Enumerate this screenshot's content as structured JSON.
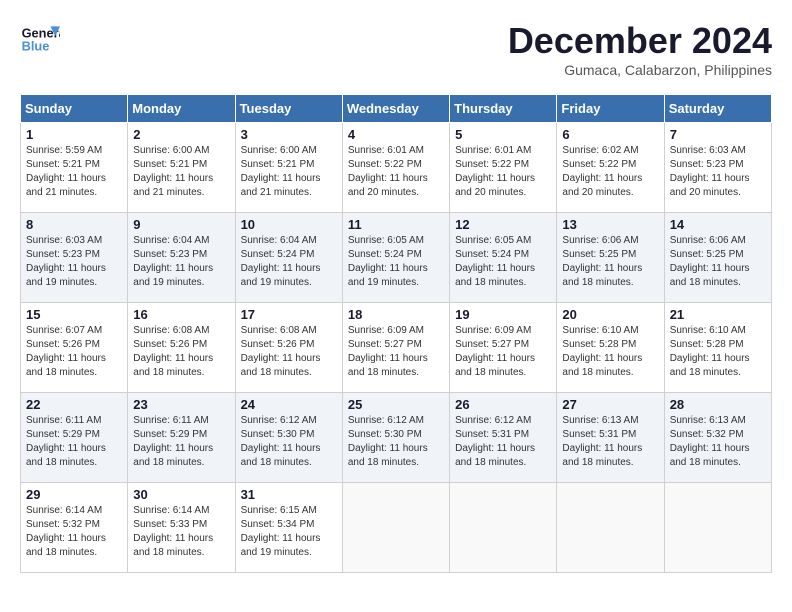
{
  "logo": {
    "line1": "General",
    "line2": "Blue"
  },
  "title": "December 2024",
  "subtitle": "Gumaca, Calabarzon, Philippines",
  "days_of_week": [
    "Sunday",
    "Monday",
    "Tuesday",
    "Wednesday",
    "Thursday",
    "Friday",
    "Saturday"
  ],
  "weeks": [
    [
      {
        "day": "1",
        "info": "Sunrise: 5:59 AM\nSunset: 5:21 PM\nDaylight: 11 hours\nand 21 minutes."
      },
      {
        "day": "2",
        "info": "Sunrise: 6:00 AM\nSunset: 5:21 PM\nDaylight: 11 hours\nand 21 minutes."
      },
      {
        "day": "3",
        "info": "Sunrise: 6:00 AM\nSunset: 5:21 PM\nDaylight: 11 hours\nand 21 minutes."
      },
      {
        "day": "4",
        "info": "Sunrise: 6:01 AM\nSunset: 5:22 PM\nDaylight: 11 hours\nand 20 minutes."
      },
      {
        "day": "5",
        "info": "Sunrise: 6:01 AM\nSunset: 5:22 PM\nDaylight: 11 hours\nand 20 minutes."
      },
      {
        "day": "6",
        "info": "Sunrise: 6:02 AM\nSunset: 5:22 PM\nDaylight: 11 hours\nand 20 minutes."
      },
      {
        "day": "7",
        "info": "Sunrise: 6:03 AM\nSunset: 5:23 PM\nDaylight: 11 hours\nand 20 minutes."
      }
    ],
    [
      {
        "day": "8",
        "info": "Sunrise: 6:03 AM\nSunset: 5:23 PM\nDaylight: 11 hours\nand 19 minutes."
      },
      {
        "day": "9",
        "info": "Sunrise: 6:04 AM\nSunset: 5:23 PM\nDaylight: 11 hours\nand 19 minutes."
      },
      {
        "day": "10",
        "info": "Sunrise: 6:04 AM\nSunset: 5:24 PM\nDaylight: 11 hours\nand 19 minutes."
      },
      {
        "day": "11",
        "info": "Sunrise: 6:05 AM\nSunset: 5:24 PM\nDaylight: 11 hours\nand 19 minutes."
      },
      {
        "day": "12",
        "info": "Sunrise: 6:05 AM\nSunset: 5:24 PM\nDaylight: 11 hours\nand 18 minutes."
      },
      {
        "day": "13",
        "info": "Sunrise: 6:06 AM\nSunset: 5:25 PM\nDaylight: 11 hours\nand 18 minutes."
      },
      {
        "day": "14",
        "info": "Sunrise: 6:06 AM\nSunset: 5:25 PM\nDaylight: 11 hours\nand 18 minutes."
      }
    ],
    [
      {
        "day": "15",
        "info": "Sunrise: 6:07 AM\nSunset: 5:26 PM\nDaylight: 11 hours\nand 18 minutes."
      },
      {
        "day": "16",
        "info": "Sunrise: 6:08 AM\nSunset: 5:26 PM\nDaylight: 11 hours\nand 18 minutes."
      },
      {
        "day": "17",
        "info": "Sunrise: 6:08 AM\nSunset: 5:26 PM\nDaylight: 11 hours\nand 18 minutes."
      },
      {
        "day": "18",
        "info": "Sunrise: 6:09 AM\nSunset: 5:27 PM\nDaylight: 11 hours\nand 18 minutes."
      },
      {
        "day": "19",
        "info": "Sunrise: 6:09 AM\nSunset: 5:27 PM\nDaylight: 11 hours\nand 18 minutes."
      },
      {
        "day": "20",
        "info": "Sunrise: 6:10 AM\nSunset: 5:28 PM\nDaylight: 11 hours\nand 18 minutes."
      },
      {
        "day": "21",
        "info": "Sunrise: 6:10 AM\nSunset: 5:28 PM\nDaylight: 11 hours\nand 18 minutes."
      }
    ],
    [
      {
        "day": "22",
        "info": "Sunrise: 6:11 AM\nSunset: 5:29 PM\nDaylight: 11 hours\nand 18 minutes."
      },
      {
        "day": "23",
        "info": "Sunrise: 6:11 AM\nSunset: 5:29 PM\nDaylight: 11 hours\nand 18 minutes."
      },
      {
        "day": "24",
        "info": "Sunrise: 6:12 AM\nSunset: 5:30 PM\nDaylight: 11 hours\nand 18 minutes."
      },
      {
        "day": "25",
        "info": "Sunrise: 6:12 AM\nSunset: 5:30 PM\nDaylight: 11 hours\nand 18 minutes."
      },
      {
        "day": "26",
        "info": "Sunrise: 6:12 AM\nSunset: 5:31 PM\nDaylight: 11 hours\nand 18 minutes."
      },
      {
        "day": "27",
        "info": "Sunrise: 6:13 AM\nSunset: 5:31 PM\nDaylight: 11 hours\nand 18 minutes."
      },
      {
        "day": "28",
        "info": "Sunrise: 6:13 AM\nSunset: 5:32 PM\nDaylight: 11 hours\nand 18 minutes."
      }
    ],
    [
      {
        "day": "29",
        "info": "Sunrise: 6:14 AM\nSunset: 5:32 PM\nDaylight: 11 hours\nand 18 minutes."
      },
      {
        "day": "30",
        "info": "Sunrise: 6:14 AM\nSunset: 5:33 PM\nDaylight: 11 hours\nand 18 minutes."
      },
      {
        "day": "31",
        "info": "Sunrise: 6:15 AM\nSunset: 5:34 PM\nDaylight: 11 hours\nand 19 minutes."
      },
      {
        "day": "",
        "info": ""
      },
      {
        "day": "",
        "info": ""
      },
      {
        "day": "",
        "info": ""
      },
      {
        "day": "",
        "info": ""
      }
    ]
  ]
}
